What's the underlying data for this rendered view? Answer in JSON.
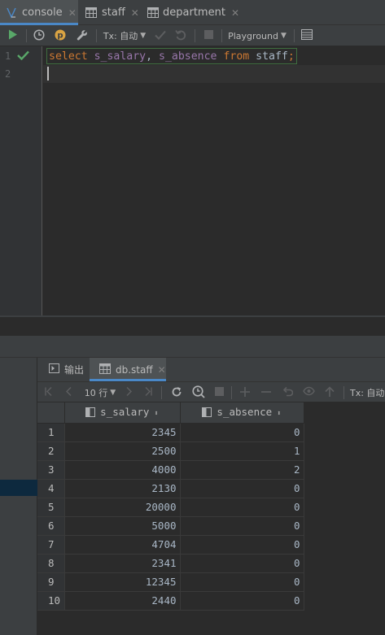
{
  "tabs": [
    {
      "label": "console",
      "icon": "console-icon",
      "active": true
    },
    {
      "label": "staff",
      "icon": "table-icon",
      "active": false
    },
    {
      "label": "department",
      "icon": "table-icon",
      "active": false
    }
  ],
  "toolbar": {
    "tx_label": "Tx: 自动",
    "playground_label": "Playground"
  },
  "editor": {
    "line_numbers": [
      "1",
      "2"
    ],
    "code": {
      "kw1": "select",
      "col1": "s_salary",
      "comma": ", ",
      "col2": "s_absence",
      "kw2": "from",
      "table": "staff",
      "semi": ";"
    }
  },
  "results": {
    "tab_output": "输出",
    "tab_table": "db.staff",
    "page_size": "10 行",
    "tx_label": "Tx: 自动",
    "columns": [
      "s_salary",
      "s_absence"
    ],
    "rows": [
      {
        "n": "1",
        "s_salary": "2345",
        "s_absence": "0"
      },
      {
        "n": "2",
        "s_salary": "2500",
        "s_absence": "1"
      },
      {
        "n": "3",
        "s_salary": "4000",
        "s_absence": "2"
      },
      {
        "n": "4",
        "s_salary": "2130",
        "s_absence": "0"
      },
      {
        "n": "5",
        "s_salary": "20000",
        "s_absence": "0"
      },
      {
        "n": "6",
        "s_salary": "5000",
        "s_absence": "0"
      },
      {
        "n": "7",
        "s_salary": "4704",
        "s_absence": "0"
      },
      {
        "n": "8",
        "s_salary": "2341",
        "s_absence": "0"
      },
      {
        "n": "9",
        "s_salary": "12345",
        "s_absence": "0"
      },
      {
        "n": "10",
        "s_salary": "2440",
        "s_absence": "0"
      }
    ]
  },
  "colors": {
    "accent": "#4a88c7",
    "run_green": "#59a869",
    "keyword": "#cc7832",
    "identifier": "#9876aa"
  }
}
